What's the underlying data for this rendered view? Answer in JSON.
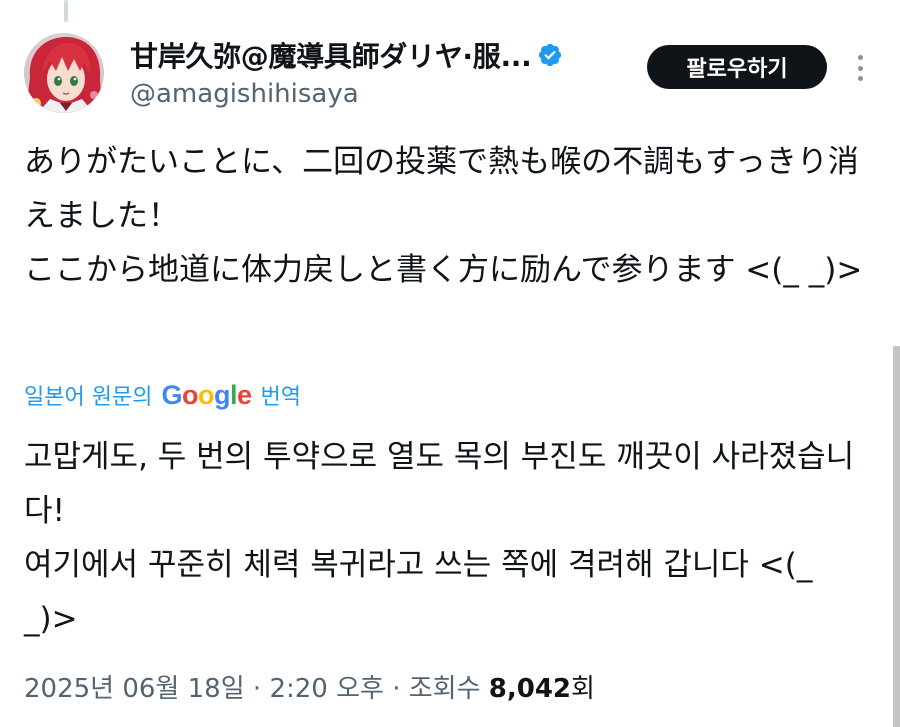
{
  "tweet": {
    "author": {
      "display_name": "甘岸久弥@魔導具師ダリヤ·服...",
      "handle": "@amagishihisaya",
      "verified": true,
      "avatar_icon": "avatar-red-hair-character"
    },
    "follow_label": "팔로우하기",
    "more_icon": "more-vertical-icon",
    "text_lines": [
      "ありがたいことに、二回の投薬で熱も喉の不調もすっきり消えました！",
      "ここから地道に体力戻しと書く方に励んで参ります <(_ _)>"
    ],
    "translate": {
      "prefix": "일본어 원문의",
      "provider": "Google",
      "suffix": "번역"
    },
    "translated_lines": [
      "고맙게도, 두 번의 투약으로 열도 목의 부진도 깨끗이 사라졌습니다!",
      "여기에서 꾸준히 체력 복귀라고 쓰는 쪽에 격려해 갑니다 <(_ _)>"
    ],
    "meta": {
      "date": "2025년 06월 18일",
      "separator": "·",
      "time": "2:20 오후",
      "views_label": "조회수",
      "views_count": "8,042",
      "views_suffix": "회"
    }
  },
  "colors": {
    "text_primary": "#0f1419",
    "text_secondary": "#536471",
    "link_blue": "#1d9bf0",
    "follow_bg": "#0f1419",
    "verified_blue": "#1d9bf0",
    "google_blue": "#4285f4",
    "google_red": "#ea4335",
    "google_yellow": "#fbbc05",
    "google_green": "#34a853"
  }
}
